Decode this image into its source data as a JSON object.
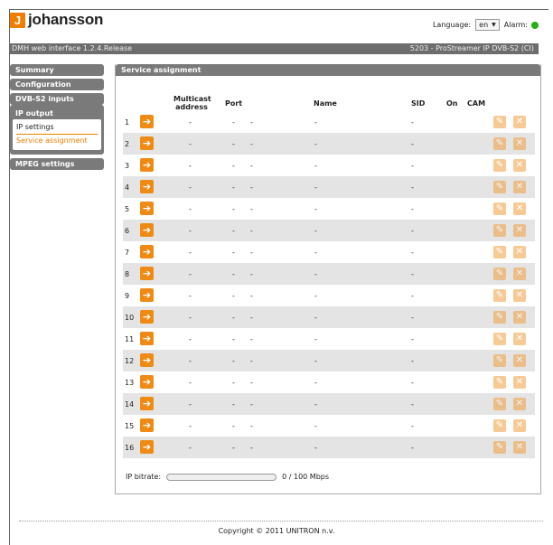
{
  "brand": {
    "logo_letter": "J",
    "name": "johansson"
  },
  "language": {
    "label": "Language:",
    "value": "en",
    "alarm_label": "Alarm:",
    "alarm_color": "#22b014"
  },
  "header": {
    "left": "DMH web interface 1.2.4.Release",
    "right": "5203 - ProStreamer IP DVB-S2 (CI)"
  },
  "nav": {
    "summary": "Summary",
    "configuration": "Configuration",
    "dvbs2": "DVB-S2 inputs",
    "ipoutput": "IP output",
    "ipsettings": "IP settings",
    "service_assignment": "Service assignment",
    "mpeg": "MPEG settings"
  },
  "panel": {
    "title": "Service assignment"
  },
  "columns": {
    "multicast_line1": "Multicast",
    "multicast_line2": "address",
    "port": "Port",
    "name": "Name",
    "sid": "SID",
    "on": "On",
    "cam": "CAM"
  },
  "rows": [
    {
      "num": "1",
      "multicast": "-",
      "port": "-",
      "port2": "-",
      "name": "-",
      "sid": "-"
    },
    {
      "num": "2",
      "multicast": "-",
      "port": "-",
      "port2": "-",
      "name": "-",
      "sid": "-"
    },
    {
      "num": "3",
      "multicast": "-",
      "port": "-",
      "port2": "-",
      "name": "-",
      "sid": "-"
    },
    {
      "num": "4",
      "multicast": "-",
      "port": "-",
      "port2": "-",
      "name": "-",
      "sid": "-"
    },
    {
      "num": "5",
      "multicast": "-",
      "port": "-",
      "port2": "-",
      "name": "-",
      "sid": "-"
    },
    {
      "num": "6",
      "multicast": "-",
      "port": "-",
      "port2": "-",
      "name": "-",
      "sid": "-"
    },
    {
      "num": "7",
      "multicast": "-",
      "port": "-",
      "port2": "-",
      "name": "-",
      "sid": "-"
    },
    {
      "num": "8",
      "multicast": "-",
      "port": "-",
      "port2": "-",
      "name": "-",
      "sid": "-"
    },
    {
      "num": "9",
      "multicast": "-",
      "port": "-",
      "port2": "-",
      "name": "-",
      "sid": "-"
    },
    {
      "num": "10",
      "multicast": "-",
      "port": "-",
      "port2": "-",
      "name": "-",
      "sid": "-"
    },
    {
      "num": "11",
      "multicast": "-",
      "port": "-",
      "port2": "-",
      "name": "-",
      "sid": "-"
    },
    {
      "num": "12",
      "multicast": "-",
      "port": "-",
      "port2": "-",
      "name": "-",
      "sid": "-"
    },
    {
      "num": "13",
      "multicast": "-",
      "port": "-",
      "port2": "-",
      "name": "-",
      "sid": "-"
    },
    {
      "num": "14",
      "multicast": "-",
      "port": "-",
      "port2": "-",
      "name": "-",
      "sid": "-"
    },
    {
      "num": "15",
      "multicast": "-",
      "port": "-",
      "port2": "-",
      "name": "-",
      "sid": "-"
    },
    {
      "num": "16",
      "multicast": "-",
      "port": "-",
      "port2": "-",
      "name": "-",
      "sid": "-"
    }
  ],
  "bitrate": {
    "label": "IP bitrate:",
    "value_text": "0 / 100 Mbps",
    "fraction": 0
  },
  "footer": {
    "copyright": "Copyright © 2011 UNITRON n.v."
  },
  "colors": {
    "accent": "#ef7d00"
  }
}
